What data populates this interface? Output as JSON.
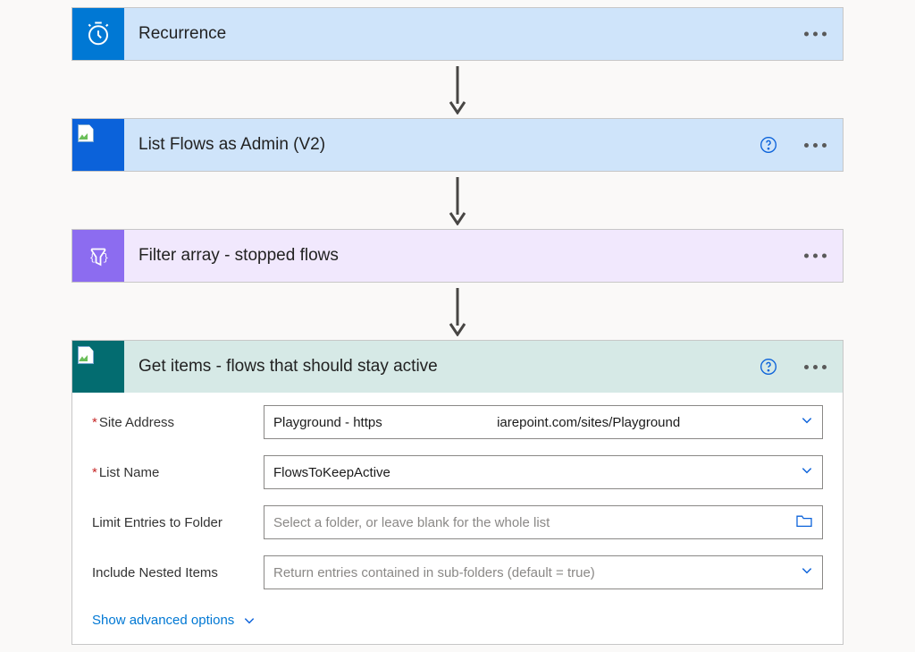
{
  "steps": {
    "recurrence": {
      "title": "Recurrence",
      "icon_name": "clock-icon"
    },
    "list_flows": {
      "title": "List Flows as Admin (V2)",
      "icon_name": "flow-icon",
      "has_help": true
    },
    "filter_array": {
      "title": "Filter array - stopped flows",
      "icon_name": "filter-icon"
    },
    "get_items": {
      "title": "Get items - flows that should stay active",
      "icon_name": "sharepoint-icon",
      "has_help": true,
      "fields": {
        "site_address": {
          "label": "Site Address",
          "required": true,
          "value_prefix": "Playground - https",
          "value_suffix": "iarepoint.com/sites/Playground",
          "control_type": "dropdown"
        },
        "list_name": {
          "label": "List Name",
          "required": true,
          "value": "FlowsToKeepActive",
          "control_type": "dropdown"
        },
        "limit_entries": {
          "label": "Limit Entries to Folder",
          "required": false,
          "placeholder": "Select a folder, or leave blank for the whole list",
          "control_type": "folder_picker"
        },
        "include_nested": {
          "label": "Include Nested Items",
          "required": false,
          "placeholder": "Return entries contained in sub-folders (default = true)",
          "control_type": "dropdown"
        }
      },
      "advanced_link": "Show advanced options"
    }
  }
}
